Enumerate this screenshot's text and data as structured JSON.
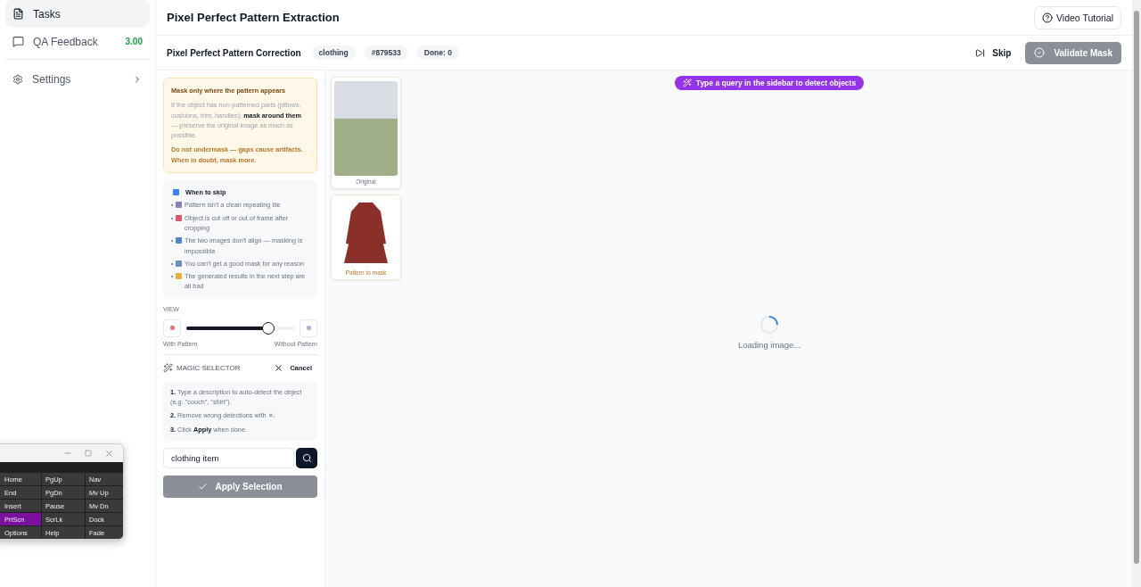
{
  "sidebar": {
    "items": [
      {
        "label": "Tasks",
        "selected": true
      },
      {
        "label": "QA Feedback",
        "selected": false,
        "badge": "3.00"
      }
    ],
    "settings": {
      "label": "Settings"
    }
  },
  "header": {
    "title": "Pixel Perfect Pattern Extraction",
    "tutorial_button": "Video Tutorial"
  },
  "toolbar": {
    "title": "Pixel Perfect Pattern Correction",
    "tags": [
      "clothing",
      "#879533",
      "Done: 0"
    ],
    "skip_button": "Skip",
    "validate_button": {
      "label": "Validate Mask",
      "disabled": true
    }
  },
  "warning": {
    "title": "Mask only where the pattern appears",
    "body": "If the object has non-patterned parts (pillows, cushions, trim, handles), **mask around them** — preserve the original image as much as possible.",
    "note": "Do not undermask — gaps cause artifacts. When in doubt, mask more."
  },
  "skip_card": {
    "title": "When to skip",
    "items": [
      {
        "text": "Pattern isn't a clean repeating tile",
        "color": "#8e7fb8"
      },
      {
        "text": "Object is cut off or out of frame after cropping",
        "color": "#e0566b"
      },
      {
        "text": "The two images don't align — masking is impossible",
        "color": "#4a86d4"
      },
      {
        "text": "You can't get a good mask for any reason",
        "color": "#6c8fc2"
      },
      {
        "text": "The generated results in the next step are all bad",
        "color": "#e8b13a"
      }
    ]
  },
  "view": {
    "label": "VIEW",
    "level": 0.76,
    "left_label": "With Pattern",
    "right_label": "Without Pattern"
  },
  "magic_selector": {
    "title": "MAGIC SELECTOR",
    "cancel": "Cancel",
    "steps": [
      "**1.** Type a description to auto-detect the object (e.g. \"couch\", \"shirt\").",
      "**2.** Remove wrong detections with ✕.",
      "**3.** Click **Apply** when done."
    ],
    "query": "clothing item",
    "apply_button": {
      "label": "Apply Selection",
      "disabled": true
    }
  },
  "canvas": {
    "hint": "Type a query in the sidebar to detect objects",
    "loading": "Loading image...",
    "thumbnails": [
      {
        "caption": "Original",
        "kind": "photo"
      },
      {
        "caption": "Pattern to mask",
        "kind": "garment"
      }
    ]
  },
  "keyboard_window": {
    "keys": [
      {
        "label": "Home",
        "selected": false
      },
      {
        "label": "PgUp",
        "selected": false
      },
      {
        "label": "Nav",
        "selected": false
      },
      {
        "label": "End",
        "selected": false
      },
      {
        "label": "PgDn",
        "selected": false
      },
      {
        "label": "Mv Up",
        "selected": false
      },
      {
        "label": "Insert",
        "selected": false
      },
      {
        "label": "Pause",
        "selected": false
      },
      {
        "label": "Mv Dn",
        "selected": false
      },
      {
        "label": "PrtScn",
        "selected": true
      },
      {
        "label": "ScrLk",
        "selected": false
      },
      {
        "label": "Dock",
        "selected": false
      },
      {
        "label": "Options",
        "selected": false
      },
      {
        "label": "Help",
        "selected": false
      },
      {
        "label": "Fade",
        "selected": false
      }
    ]
  }
}
